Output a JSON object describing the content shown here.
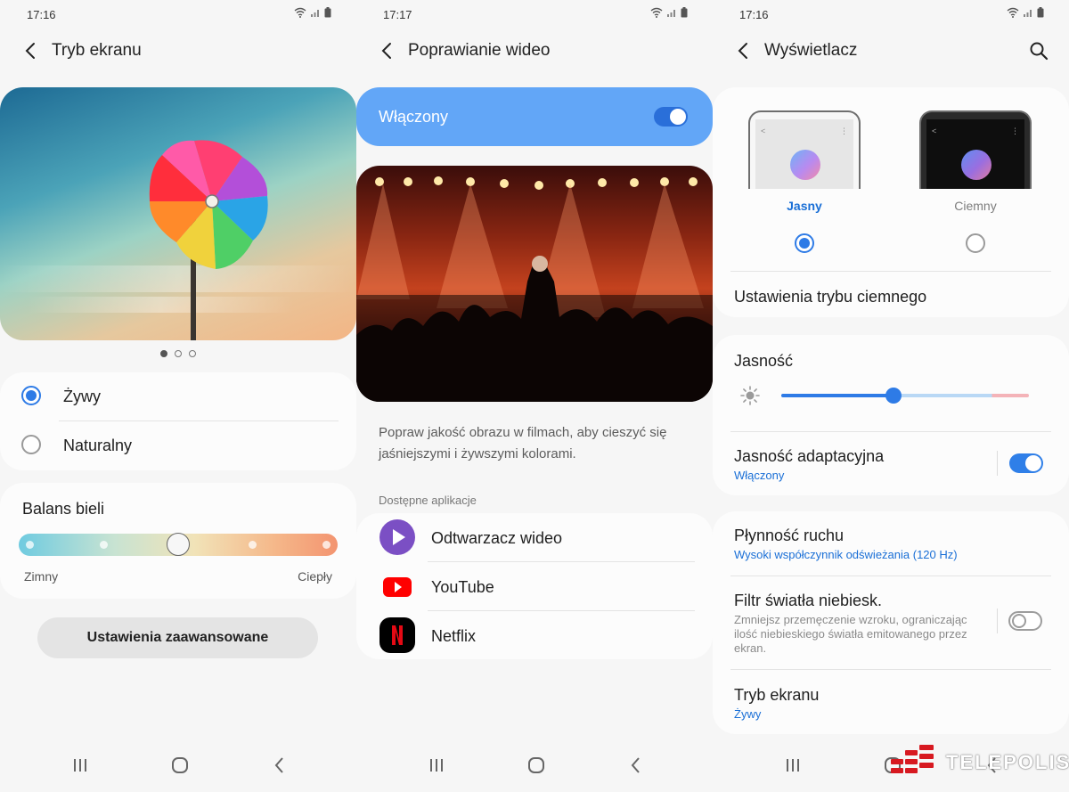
{
  "screen1": {
    "status_time": "17:16",
    "title": "Tryb ekranu",
    "modes": [
      {
        "label": "Żywy",
        "selected": true
      },
      {
        "label": "Naturalny",
        "selected": false
      }
    ],
    "white_balance": {
      "title": "Balans bieli",
      "left_label": "Zimny",
      "right_label": "Ciepły",
      "steps": 5,
      "value_step": 3
    },
    "advanced_button": "Ustawienia zaawansowane",
    "carousel": {
      "pages": 3,
      "active": 1
    }
  },
  "screen2": {
    "status_time": "17:17",
    "title": "Poprawianie wideo",
    "master_switch": {
      "label": "Włączony",
      "on": true
    },
    "description": "Popraw jakość obrazu w filmach, aby cieszyć się jaśniejszymi i żywszymi kolorami.",
    "apps_header": "Dostępne aplikacje",
    "apps": [
      {
        "name": "Odtwarzacz wideo",
        "icon": "video-player-icon",
        "color": "#7b4fc4"
      },
      {
        "name": "YouTube",
        "icon": "youtube-icon",
        "color": "#ff0000"
      },
      {
        "name": "Netflix",
        "icon": "netflix-icon",
        "color": "#e50914"
      }
    ]
  },
  "screen3": {
    "status_time": "17:16",
    "title": "Wyświetlacz",
    "themes": [
      {
        "label": "Jasny",
        "selected": true
      },
      {
        "label": "Ciemny",
        "selected": false
      }
    ],
    "dark_mode_settings": "Ustawienia trybu ciemnego",
    "brightness": {
      "title": "Jasność",
      "value_percent": 45
    },
    "adaptive_brightness": {
      "label": "Jasność adaptacyjna",
      "sub": "Włączony",
      "on": true
    },
    "motion_smoothness": {
      "label": "Płynność ruchu",
      "sub": "Wysoki współczynnik odświeżania (120 Hz)"
    },
    "blue_light_filter": {
      "label": "Filtr światła niebiesk.",
      "desc": "Zmniejsz przemęczenie wzroku, ograniczając ilość niebieskiego światła emitowanego przez ekran.",
      "on": false
    },
    "screen_mode": {
      "label": "Tryb ekranu",
      "sub": "Żywy"
    }
  },
  "watermark": "TELEPOLIS",
  "colors": {
    "accent": "#2e7be6",
    "switch_banner": "#62a6f7",
    "link": "#1a6fd6"
  }
}
